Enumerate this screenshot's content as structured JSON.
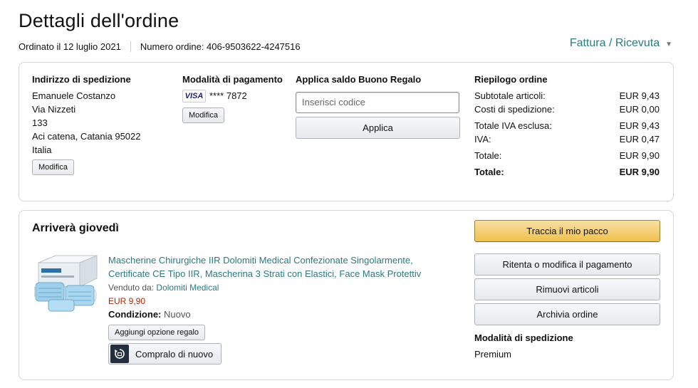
{
  "header": {
    "title": "Dettagli dell'ordine",
    "ordered_on": "Ordinato il 12 luglio 2021",
    "order_number": "Numero ordine: 406-9503622-4247516",
    "invoice_link": "Fattura / Ricevuta",
    "invoice_chevron_icon": "chevron-down-icon"
  },
  "shipping_address": {
    "title": "Indirizzo di spedizione",
    "lines": [
      "Emanuele Costanzo",
      "Via Nizzeti",
      "133",
      "Aci catena, Catania 95022",
      "Italia"
    ],
    "edit_label": "Modifica"
  },
  "payment": {
    "title": "Modalità di pagamento",
    "card_brand": "VISA",
    "card_number": "**** 7872",
    "edit_label": "Modifica"
  },
  "gift_card": {
    "title": "Applica saldo Buono Regalo",
    "placeholder": "Inserisci codice",
    "apply_label": "Applica"
  },
  "summary": {
    "title": "Riepilogo ordine",
    "rows": [
      {
        "label": "Subtotale articoli:",
        "value": "EUR 9,43"
      },
      {
        "label": "Costi di spedizione:",
        "value": "EUR 0,00"
      },
      {
        "label": "Totale IVA esclusa:",
        "value": "EUR 9,43"
      },
      {
        "label": "IVA:",
        "value": "EUR 0,47"
      },
      {
        "label": "Totale:",
        "value": "EUR 9,90"
      },
      {
        "label": "Totale:",
        "value": "EUR 9,90"
      }
    ]
  },
  "delivery": {
    "arrival": "Arriverà giovedì",
    "product_title": "Mascherine Chirurgiche IIR Dolomiti Medical Confezionate Singolarmente, Certificate CE Tipo IIR, Mascherina 3 Strati con Elastici, Face Mask Protettiv",
    "sold_by_label": "Venduto da:",
    "seller": "Dolomiti Medical",
    "price": "EUR 9,90",
    "condition_label": "Condizione:",
    "condition_value": "Nuovo",
    "gift_option_label": "Aggiungi opzione regalo",
    "buy_again_label": "Compralo di nuovo",
    "buy_again_icon": "buy-again-icon"
  },
  "actions": {
    "track": "Traccia il mio pacco",
    "retry_payment": "Ritenta o modifica il pagamento",
    "remove_items": "Rimuovi articoli",
    "archive": "Archivia ordine",
    "shipping_method_title": "Modalità di spedizione",
    "shipping_method": "Premium"
  },
  "colors": {
    "link": "#2b7a82",
    "price": "#b12704",
    "primary_button": "#f0c14b",
    "border": "#d5d9d9"
  }
}
